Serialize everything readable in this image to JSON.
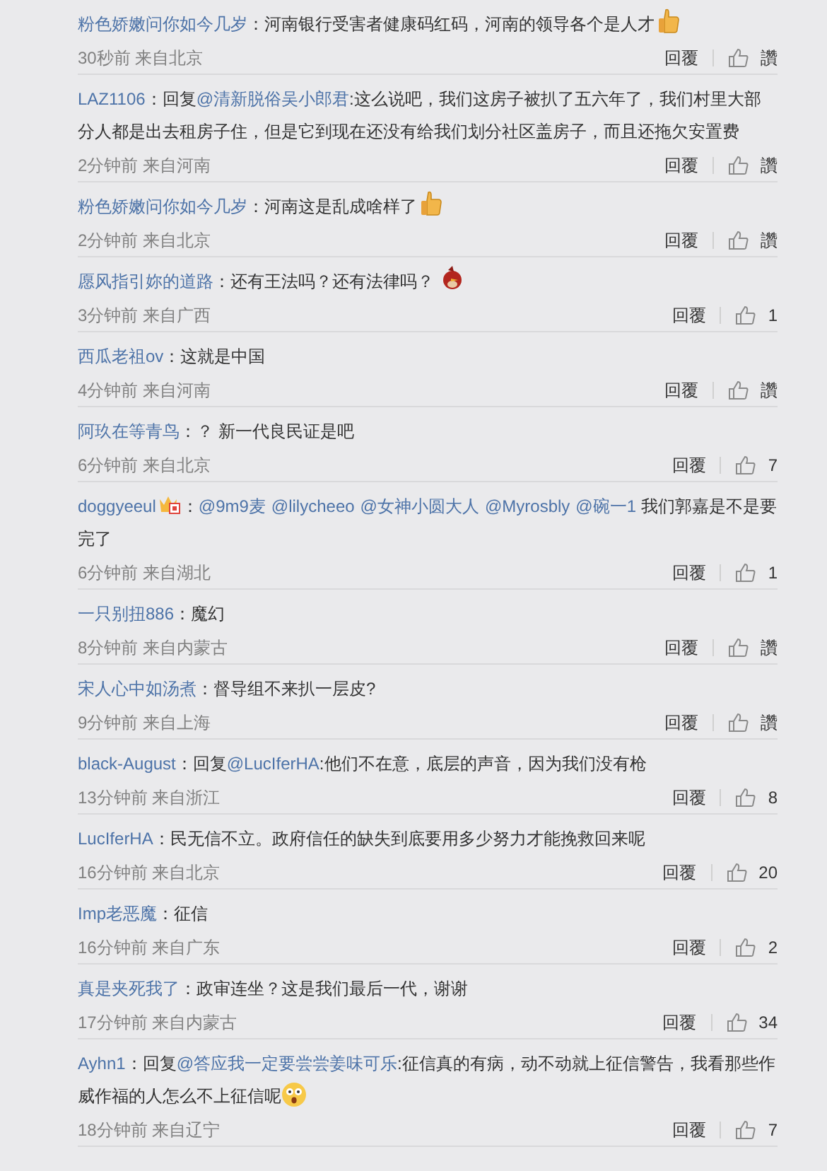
{
  "comments": [
    {
      "user": "粉色娇嫩问你如今几岁",
      "body": [
        {
          "kind": "text",
          "text": "：河南银行受害者健康码红码，河南的领导各个是人才"
        },
        {
          "kind": "thumbs"
        }
      ],
      "meta": "30秒前 来自北京",
      "reply": "回覆",
      "like": "讚"
    },
    {
      "user": "LAZ1106",
      "body": [
        {
          "kind": "text",
          "text": "：回复"
        },
        {
          "kind": "mention",
          "text": "@清新脱俗吴小郎君"
        },
        {
          "kind": "text",
          "text": ":这么说吧，我们这房子被扒了五六年了，我们村里大部分人都是出去租房子住，但是它到现在还没有给我们划分社区盖房子，而且还拖欠安置费"
        }
      ],
      "meta": "2分钟前 来自河南",
      "reply": "回覆",
      "like": "讚"
    },
    {
      "user": "粉色娇嫩问你如今几岁",
      "body": [
        {
          "kind": "text",
          "text": "：河南这是乱成啥样了"
        },
        {
          "kind": "thumbs"
        }
      ],
      "meta": "2分钟前 来自北京",
      "reply": "回覆",
      "like": "讚"
    },
    {
      "user": "愿风指引妳的道路",
      "body": [
        {
          "kind": "text",
          "text": "：还有王法吗？还有法律吗？"
        },
        {
          "kind": "bird"
        }
      ],
      "meta": "3分钟前 来自广西",
      "reply": "回覆",
      "like": "1"
    },
    {
      "user": "西瓜老祖ov",
      "body": [
        {
          "kind": "text",
          "text": "：这就是中国"
        }
      ],
      "meta": "4分钟前 来自河南",
      "reply": "回覆",
      "like": "讚"
    },
    {
      "user": "阿玖在等青鸟",
      "body": [
        {
          "kind": "text",
          "text": "：？ 新一代良民证是吧"
        }
      ],
      "meta": "6分钟前 来自北京",
      "reply": "回覆",
      "like": "7"
    },
    {
      "user": "doggyeeul",
      "badge": true,
      "body": [
        {
          "kind": "text",
          "text": "："
        },
        {
          "kind": "mention",
          "text": "@9m9麦"
        },
        {
          "kind": "mention",
          "text": "@lilycheeo"
        },
        {
          "kind": "mention",
          "text": "@女神小圆大人"
        },
        {
          "kind": "mention",
          "text": "@Myrosbly"
        },
        {
          "kind": "mention",
          "text": "@碗一1"
        },
        {
          "kind": "text",
          "text": " 我们郭嘉是不是要完了"
        }
      ],
      "meta": "6分钟前 来自湖北",
      "reply": "回覆",
      "like": "1"
    },
    {
      "user": "一只别扭886",
      "body": [
        {
          "kind": "text",
          "text": "：魔幻"
        }
      ],
      "meta": "8分钟前 来自内蒙古",
      "reply": "回覆",
      "like": "讚"
    },
    {
      "user": "宋人心中如汤煮",
      "body": [
        {
          "kind": "text",
          "text": "：督导组不来扒一层皮?"
        }
      ],
      "meta": "9分钟前 来自上海",
      "reply": "回覆",
      "like": "讚"
    },
    {
      "user": "black-August",
      "body": [
        {
          "kind": "text",
          "text": "：回复"
        },
        {
          "kind": "mention",
          "text": "@LucIferHA"
        },
        {
          "kind": "text",
          "text": ":他们不在意，底层的声音，因为我们没有枪"
        }
      ],
      "meta": "13分钟前 来自浙江",
      "reply": "回覆",
      "like": "8"
    },
    {
      "user": "LucIferHA",
      "body": [
        {
          "kind": "text",
          "text": "：民无信不立。政府信任的缺失到底要用多少努力才能挽救回来呢"
        }
      ],
      "meta": "16分钟前 来自北京",
      "reply": "回覆",
      "like": "20"
    },
    {
      "user": "Imp老恶魔",
      "body": [
        {
          "kind": "text",
          "text": "：征信"
        }
      ],
      "meta": "16分钟前 来自广东",
      "reply": "回覆",
      "like": "2"
    },
    {
      "user": "真是夹死我了",
      "body": [
        {
          "kind": "text",
          "text": "：政审连坐？这是我们最后一代，谢谢"
        }
      ],
      "meta": "17分钟前 来自内蒙古",
      "reply": "回覆",
      "like": "34"
    },
    {
      "user": "Ayhn1",
      "body": [
        {
          "kind": "text",
          "text": "：回复"
        },
        {
          "kind": "mention",
          "text": "@答应我一定要尝尝姜味可乐"
        },
        {
          "kind": "text",
          "text": ":征信真的有病，动不动就上征信警告，我看那些作威作福的人怎么不上征信呢"
        },
        {
          "kind": "surprised"
        }
      ],
      "meta": "18分钟前 来自辽宁",
      "reply": "回覆",
      "like": "7"
    }
  ]
}
